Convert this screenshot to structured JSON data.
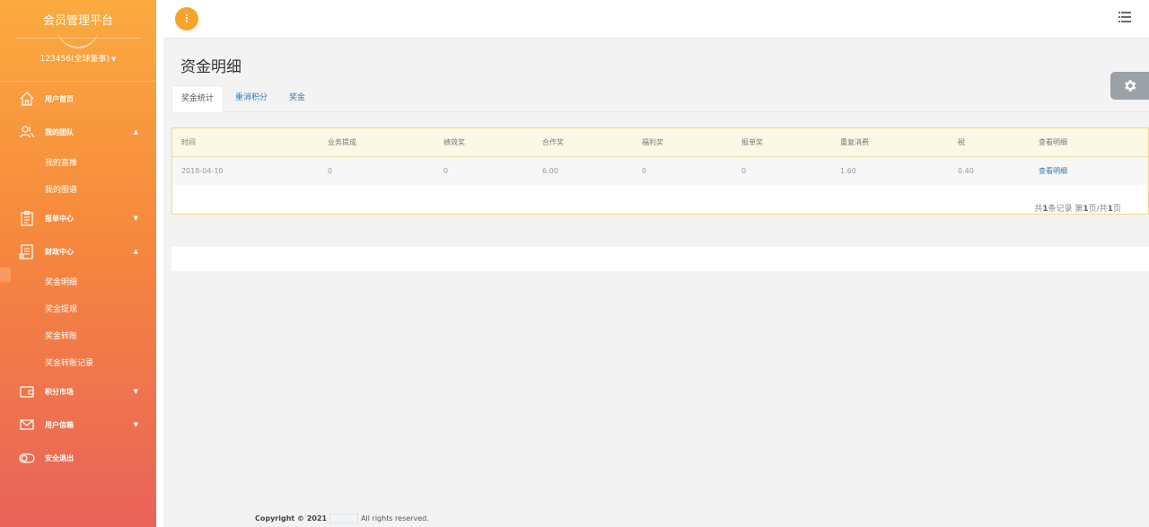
{
  "sidebar": {
    "brand": "会员管理平台",
    "user": "123456(全球董事)",
    "items": [
      {
        "label": "用户首页"
      },
      {
        "label": "我的团队",
        "subitems": [
          "我的直推",
          "我的图谱"
        ]
      },
      {
        "label": "报单中心"
      },
      {
        "label": "财政中心",
        "subitems": [
          "奖金明细",
          "奖金提现",
          "奖金转账",
          "奖金转账记录"
        ]
      },
      {
        "label": "积分市场"
      },
      {
        "label": "用户信箱"
      },
      {
        "label": "安全退出"
      }
    ]
  },
  "topbar": {
    "menu_button_icon": "ellipsis-vertical",
    "right_icon": "list-icon"
  },
  "main": {
    "title": "资金明细",
    "tabs": [
      "奖金统计",
      "重消积分",
      "奖金"
    ],
    "active_tab": 0,
    "table": {
      "headers": [
        "时间",
        "业务提成",
        "绩效奖",
        "合作奖",
        "福利奖",
        "报单奖",
        "重复消费",
        "税",
        "查看明细"
      ],
      "rows": [
        [
          "2018-04-10",
          "0",
          "0",
          "6.00",
          "0",
          "0",
          "1.60",
          "0.40",
          "查看明细"
        ]
      ]
    },
    "pager": {
      "prefix": "共",
      "count": "1",
      "mid1": "条记录 第",
      "page": "1",
      "mid2": "页/共",
      "total": "1",
      "suffix": "页"
    }
  },
  "footer": {
    "copyright": "Copyright © 2021",
    "rights": "All rights reserved."
  },
  "colors": {
    "sidebar_top": "#fbaa3e",
    "sidebar_bottom": "#e9635a",
    "accent": "#f8a42b",
    "link": "#337ab7"
  }
}
